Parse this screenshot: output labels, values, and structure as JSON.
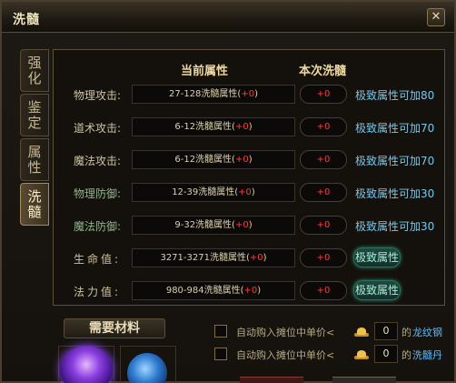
{
  "window": {
    "title": "洗髓",
    "close_symbol": "✕"
  },
  "tabs": [
    {
      "label": "强化",
      "active": false
    },
    {
      "label": "鉴定",
      "active": false
    },
    {
      "label": "属性",
      "active": false
    },
    {
      "label": "洗髓",
      "active": true
    }
  ],
  "headers": {
    "current": "当前属性",
    "wash": "本次洗髓"
  },
  "rows": [
    {
      "label": "物理攻击:",
      "cur_prefix": "27-128洗髓属性(",
      "cur_value": "+0",
      "cur_suffix": ")",
      "wash": "+0",
      "extreme": "极致属性可加80"
    },
    {
      "label": "道术攻击:",
      "cur_prefix": "6-12洗髓属性(",
      "cur_value": "+0",
      "cur_suffix": ")",
      "wash": "+0",
      "extreme": "极致属性可加70"
    },
    {
      "label": "魔法攻击:",
      "cur_prefix": "6-12洗髓属性(",
      "cur_value": "+0",
      "cur_suffix": ")",
      "wash": "+0",
      "extreme": "极致属性可加70"
    },
    {
      "label": "物理防御:",
      "cur_prefix": "12-39洗髓属性(",
      "cur_value": "+0",
      "cur_suffix": ")",
      "wash": "+0",
      "extreme": "极致属性可加30"
    },
    {
      "label": "魔法防御:",
      "cur_prefix": "9-32洗髓属性(",
      "cur_value": "+0",
      "cur_suffix": ")",
      "wash": "+0",
      "extreme": "极致属性可加30"
    },
    {
      "label": "生命值:",
      "cur_prefix": "3271-3271洗髓属性(",
      "cur_value": "+0",
      "cur_suffix": ")",
      "wash": "+0",
      "extreme": "极致属性"
    },
    {
      "label": "法力值:",
      "cur_prefix": "980-984洗髓属性(",
      "cur_value": "+0",
      "cur_suffix": ")",
      "wash": "+0",
      "extreme": "极致属性"
    }
  ],
  "materials": {
    "title": "需要材料"
  },
  "auto_buy": [
    {
      "text": "自动购入摊位中单价<",
      "qty": "0",
      "unit": "的",
      "item": "龙纹钢"
    },
    {
      "text": "自动购入摊位中单价<",
      "qty": "0",
      "unit": "的",
      "item": "洗髓丹"
    }
  ]
}
